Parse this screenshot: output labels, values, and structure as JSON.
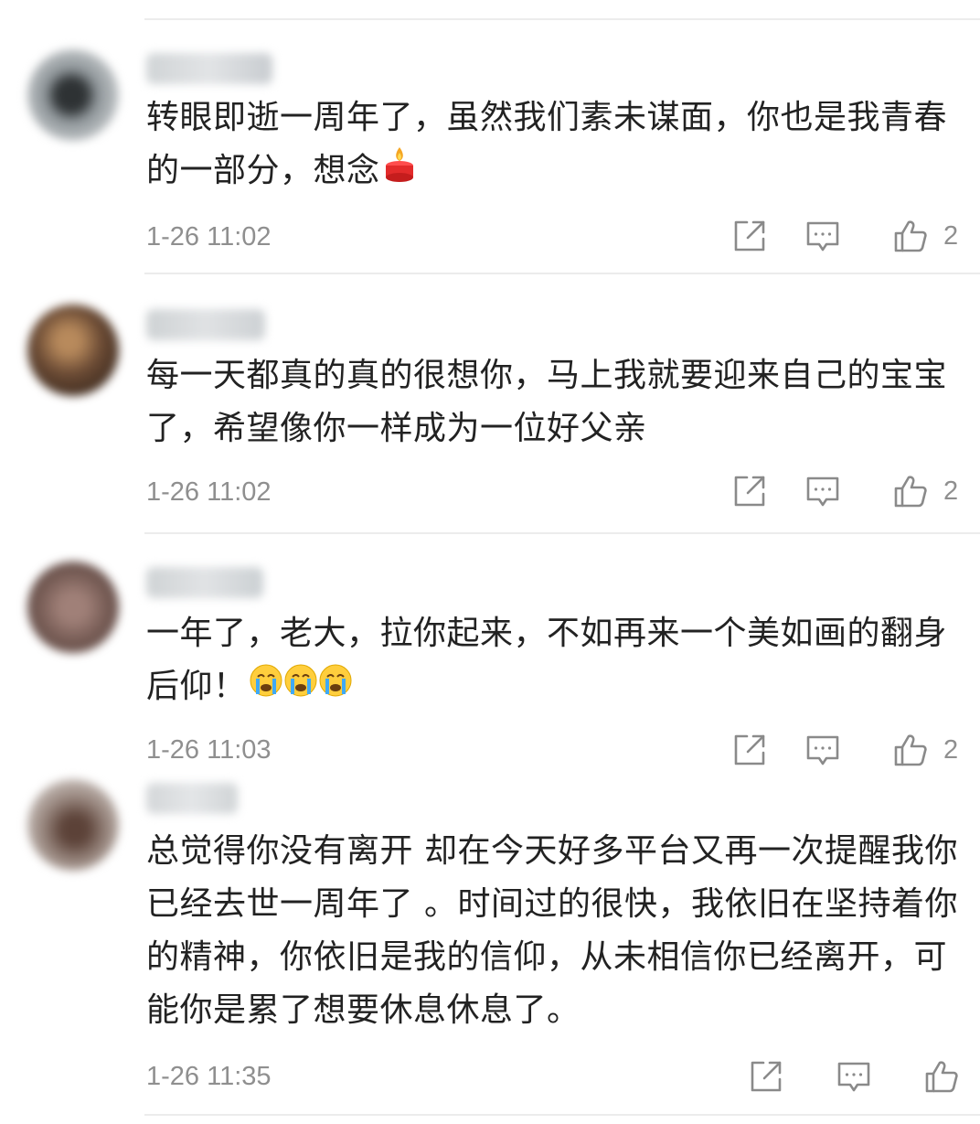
{
  "comments": [
    {
      "text": "转眼即逝一周年了，虽然我们素未谋面，你也是我青春的一部分，想念",
      "emoji": "candle",
      "time": "1-26 11:02",
      "likes": "2",
      "avatar_color": "#7d8488"
    },
    {
      "text": "每一天都真的真的很想你，马上我就要迎来自己的宝宝了，希望像你一样成为一位好父亲",
      "time": "1-26 11:02",
      "likes": "2",
      "avatar_color": "#6a4a34"
    },
    {
      "text": "一年了，老大，拉你起来，不如再来一个美如画的翻身后仰！",
      "emoji": "crying-face x3",
      "time": "1-26 11:03",
      "likes": "2",
      "avatar_color": "#7a5f58"
    },
    {
      "text": "总觉得你没有离开 却在今天好多平台又再一次提醒我你已经去世一周年了 。时间过的很快，我依旧在坚持着你的精神，你依旧是我的信仰，从未相信你已经离开，可能你是累了想要休息休息了。",
      "time": "1-26 11:35",
      "likes": "",
      "avatar_color": "#9b8a82"
    }
  ],
  "colors": {
    "text": "#222222",
    "meta": "#8f8f8f",
    "icon": "#888888",
    "divider": "#ececec"
  },
  "icons": [
    "share-icon",
    "comment-icon",
    "like-icon"
  ]
}
